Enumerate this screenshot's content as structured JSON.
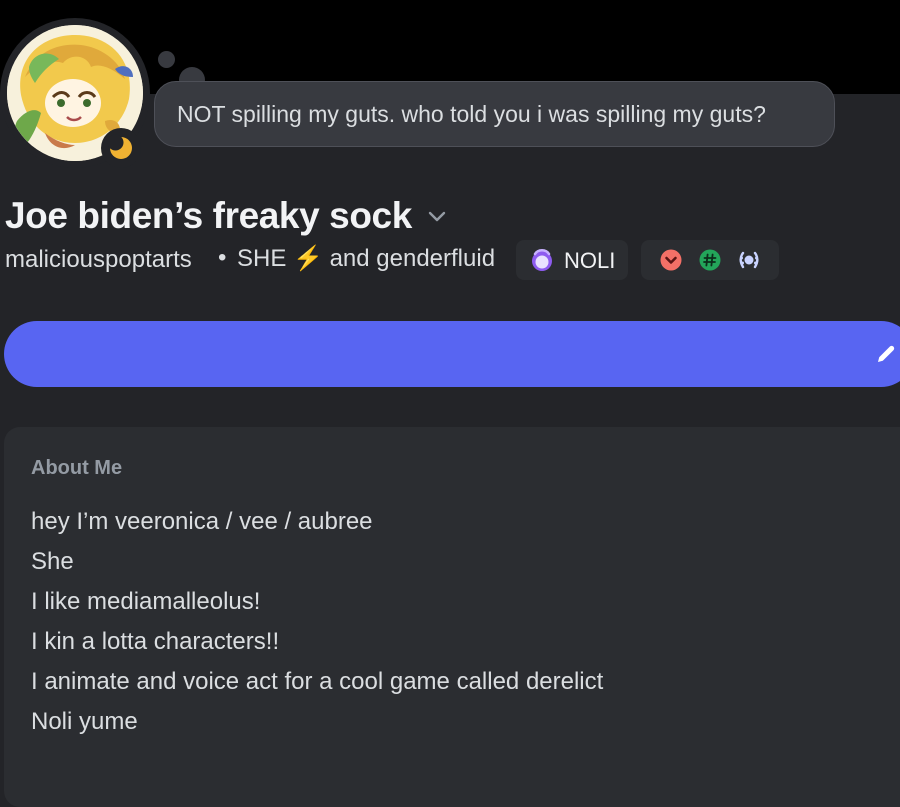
{
  "status": {
    "text": "NOT spilling my guts. who told you i was spilling my guts?"
  },
  "profile": {
    "display_name": "Joe biden’s freaky sock",
    "username": "maliciouspoptarts",
    "separator": "•",
    "pronouns": "SHE ⚡ and genderfluid",
    "clan_tag": "NOLI",
    "status_indicator": "idle-moon-icon"
  },
  "badges": [
    {
      "icon": "heart-chevron-badge-icon",
      "color": "#f47067"
    },
    {
      "icon": "hashtag-badge-icon",
      "color": "#23a55a"
    },
    {
      "icon": "laurel-badge-icon",
      "color": "#c9d3ff"
    }
  ],
  "about": {
    "heading": "About Me",
    "lines": [
      "hey I’m veeronica / vee / aubree",
      "She",
      "I like mediamalleolus!",
      "I kin a lotta characters!!",
      "I animate and voice act for a cool game called derelict",
      "Noli yume"
    ]
  },
  "colors": {
    "page_background": "#232428",
    "card_background": "#2b2d31",
    "accent": "#5865f2",
    "status_bubble": "#383a40",
    "idle_status": "#f0b232"
  }
}
